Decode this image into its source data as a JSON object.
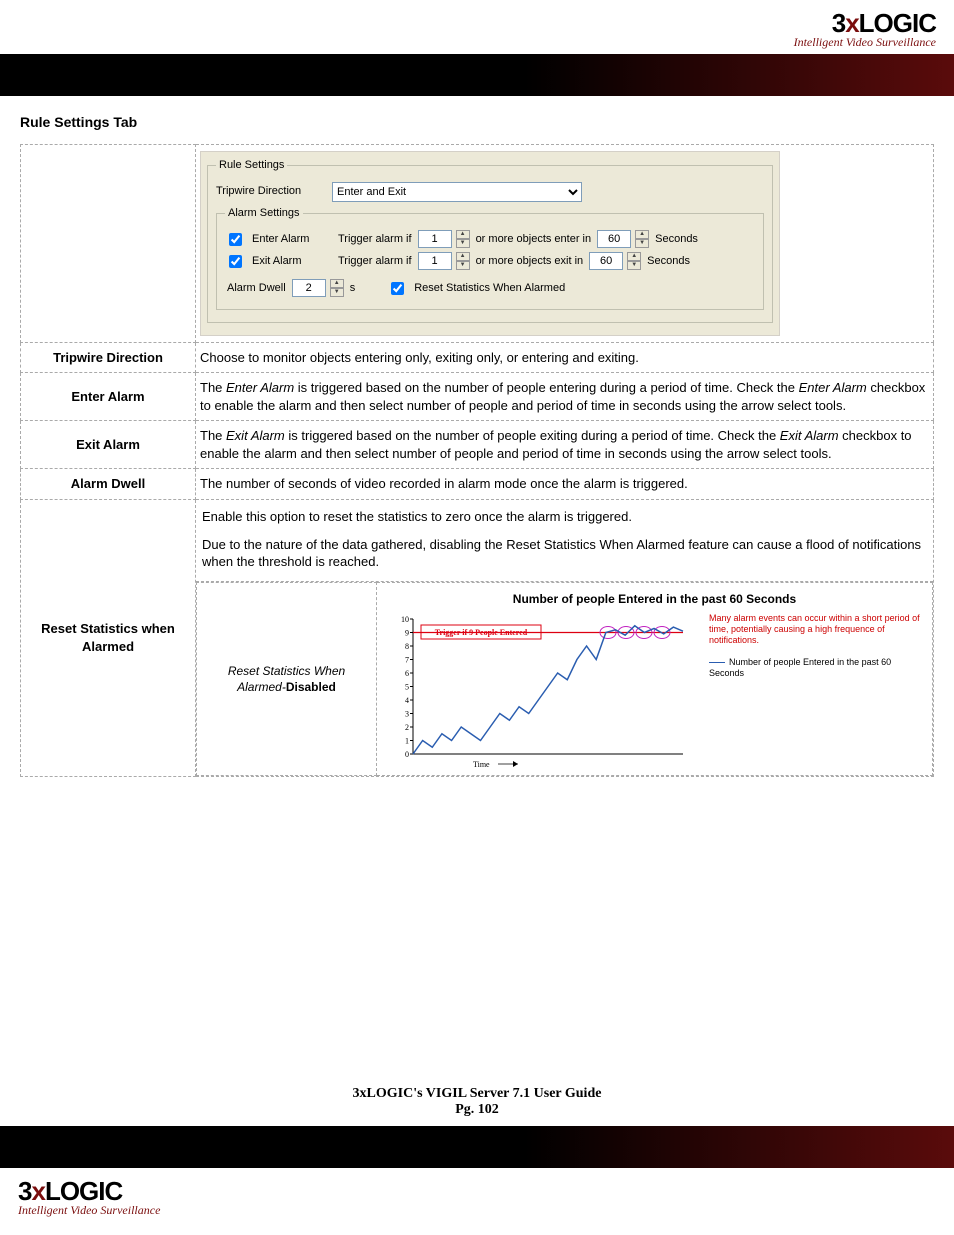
{
  "brand": {
    "name_part1": "3",
    "name_x": "x",
    "name_part2": "LOGIC",
    "tagline": "Intelligent Video Surveillance"
  },
  "section_title": "Rule Settings Tab",
  "rule_settings": {
    "legend": "Rule Settings",
    "tripwire_label": "Tripwire Direction",
    "tripwire_value": "Enter and Exit",
    "alarm_legend": "Alarm Settings",
    "enter_alarm_label": "Enter Alarm",
    "exit_alarm_label": "Exit Alarm",
    "trigger_prefix": "Trigger alarm if",
    "enter_count": "1",
    "enter_mid": "or more objects enter in",
    "enter_seconds": "60",
    "exit_count": "1",
    "exit_mid": "or more objects exit in",
    "exit_seconds": "60",
    "seconds_label": "Seconds",
    "dwell_label": "Alarm Dwell",
    "dwell_value": "2",
    "dwell_unit": "s",
    "reset_label": "Reset Statistics When Alarmed"
  },
  "rows": {
    "tripwire": {
      "label": "Tripwire Direction",
      "desc": "Choose to monitor objects entering only, exiting only, or entering and exiting."
    },
    "enter": {
      "label": "Enter Alarm",
      "em1": "Enter Alarm",
      "txt1": " is triggered based on the number of people entering during a period of time. Check the ",
      "em2": "Enter Alarm",
      "txt2": " checkbox to enable the alarm and then select number of people and period of time in seconds using the arrow select tools.",
      "pre": "The "
    },
    "exit": {
      "label": "Exit Alarm",
      "pre": "The ",
      "em1": "Exit Alarm",
      "txt1": " is triggered based on the number of people exiting during a period of time. Check the ",
      "em2": "Exit Alarm",
      "txt2": " checkbox to enable the alarm and then select number of people and period of time in seconds using the arrow select tools."
    },
    "dwell": {
      "label": "Alarm Dwell",
      "desc": "The number of seconds of video recorded in alarm mode once the alarm is triggered."
    },
    "reset": {
      "label": "Reset Statistics when Alarmed",
      "p1": "Enable this option to reset the statistics to zero once the alarm is triggered.",
      "p2": "Due to the nature of the data gathered, disabling the Reset Statistics When Alarmed feature can cause a flood of notifications when the threshold is reached.",
      "caption_em": "Reset Statistics When Alarmed-",
      "caption_bold": "Disabled"
    }
  },
  "chart_data": {
    "type": "line",
    "title": "Number of people Entered in the past 60 Seconds",
    "ylabel": "",
    "xlabel": "Time",
    "ylim": [
      0,
      10
    ],
    "yticks": [
      0,
      1,
      2,
      3,
      4,
      5,
      6,
      7,
      8,
      9,
      10
    ],
    "series": [
      {
        "name": "Number of people Entered in the past 60 Seconds",
        "color": "#2a5db0",
        "values": [
          0,
          1,
          0.5,
          1.5,
          1,
          2,
          1.5,
          1,
          2,
          3,
          2.5,
          3.5,
          3,
          4,
          5,
          6,
          5.5,
          7,
          8,
          7,
          9,
          9.2,
          8.8,
          9.5,
          9,
          9.3,
          8.9,
          9.4,
          9.1
        ]
      }
    ],
    "trigger_line": {
      "value": 9,
      "label": "Trigger if 9 People Entered",
      "color": "#cc0000"
    },
    "legend": {
      "warning": "Many alarm events can occur within a short period of time, potentially causing a high frequence of notifications.",
      "series_label": "Number of people Entered in the past 60 Seconds"
    }
  },
  "footer": {
    "title": "3xLOGIC's VIGIL Server 7.1 User Guide",
    "page": "Pg. 102"
  }
}
